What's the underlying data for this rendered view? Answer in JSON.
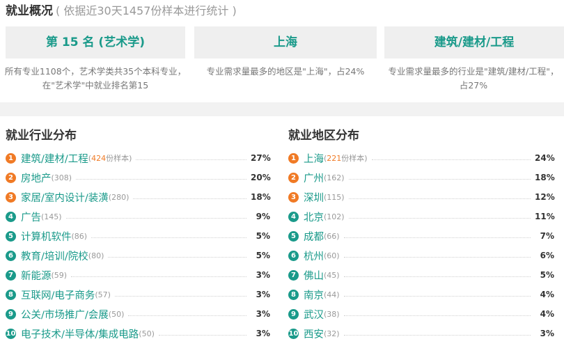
{
  "header": {
    "title": "就业概况",
    "subtitle": "( 依据近30天1457份样本进行统计 )"
  },
  "cards": [
    {
      "title": "第 15 名 (艺术学)",
      "desc": "所有专业1108个，艺术学类共35个本科专业，在\"艺术学\"中就业排名第15"
    },
    {
      "title": "上海",
      "desc": "专业需求量最多的地区是\"上海\"，占24%"
    },
    {
      "title": "建筑/建材/工程",
      "desc": "专业需求量最多的行业是\"建筑/建材/工程\"，占27%"
    }
  ],
  "industry": {
    "title": "就业行业分布",
    "items": [
      {
        "rank": "1",
        "name": "建筑/建材/工程",
        "count_open": "(",
        "count": "424",
        "count_suffix": "份样本)",
        "pct": "27%"
      },
      {
        "rank": "2",
        "name": "房地产",
        "count_text": "(308)",
        "pct": "20%"
      },
      {
        "rank": "3",
        "name": "家居/室内设计/装潢",
        "count_text": "(280)",
        "pct": "18%"
      },
      {
        "rank": "4",
        "name": "广告",
        "count_text": "(145)",
        "pct": "9%"
      },
      {
        "rank": "5",
        "name": "计算机软件",
        "count_text": "(86)",
        "pct": "5%"
      },
      {
        "rank": "6",
        "name": "教育/培训/院校",
        "count_text": "(80)",
        "pct": "5%"
      },
      {
        "rank": "7",
        "name": "新能源",
        "count_text": "(59)",
        "pct": "3%"
      },
      {
        "rank": "8",
        "name": "互联网/电子商务",
        "count_text": "(57)",
        "pct": "3%"
      },
      {
        "rank": "9",
        "name": "公关/市场推广/会展",
        "count_text": "(50)",
        "pct": "3%"
      },
      {
        "rank": "10",
        "name": "电子技术/半导体/集成电路",
        "count_text": "(50)",
        "pct": "3%"
      }
    ]
  },
  "region": {
    "title": "就业地区分布",
    "items": [
      {
        "rank": "1",
        "name": "上海",
        "count_open": "(",
        "count": "221",
        "count_suffix": "份样本)",
        "pct": "24%"
      },
      {
        "rank": "2",
        "name": "广州",
        "count_text": "(162)",
        "pct": "18%"
      },
      {
        "rank": "3",
        "name": "深圳",
        "count_text": "(115)",
        "pct": "12%"
      },
      {
        "rank": "4",
        "name": "北京",
        "count_text": "(102)",
        "pct": "11%"
      },
      {
        "rank": "5",
        "name": "成都",
        "count_text": "(66)",
        "pct": "7%"
      },
      {
        "rank": "6",
        "name": "杭州",
        "count_text": "(60)",
        "pct": "6%"
      },
      {
        "rank": "7",
        "name": "佛山",
        "count_text": "(45)",
        "pct": "5%"
      },
      {
        "rank": "8",
        "name": "南京",
        "count_text": "(44)",
        "pct": "4%"
      },
      {
        "rank": "9",
        "name": "武汉",
        "count_text": "(38)",
        "pct": "4%"
      },
      {
        "rank": "10",
        "name": "西安",
        "count_text": "(32)",
        "pct": "3%"
      }
    ]
  },
  "colors": {
    "accent": "#1a9a8a",
    "hot": "#f07a25",
    "card_bg": "#efefef",
    "divider_bg": "#f2f2f2"
  }
}
